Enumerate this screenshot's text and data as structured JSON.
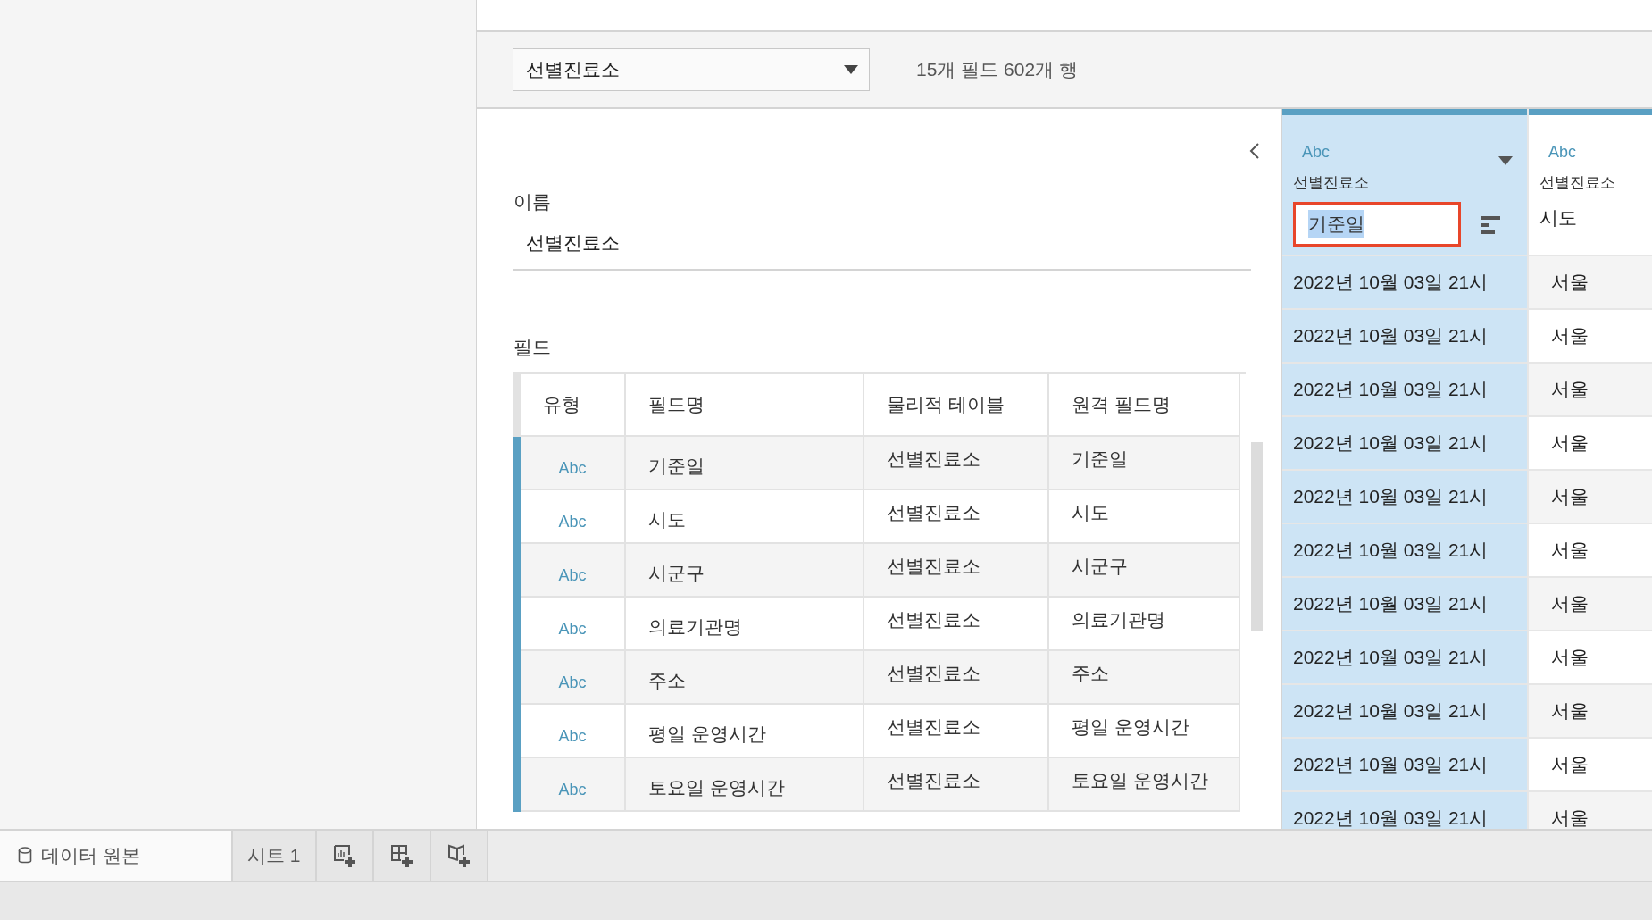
{
  "data_source_select": {
    "value": "선별진료소"
  },
  "summary": "15개 필드 602개 행",
  "name_field": {
    "label": "이름",
    "value": "선별진료소"
  },
  "fields_label": "필드",
  "fields_table": {
    "columns": [
      "유형",
      "필드명",
      "물리적 테이블",
      "원격 필드명"
    ],
    "rows": [
      {
        "type": "Abc",
        "field_name": "기준일",
        "physical_table": "선별진료소",
        "remote_field_name": "기준일"
      },
      {
        "type": "Abc",
        "field_name": "시도",
        "physical_table": "선별진료소",
        "remote_field_name": "시도"
      },
      {
        "type": "Abc",
        "field_name": "시군구",
        "physical_table": "선별진료소",
        "remote_field_name": "시군구"
      },
      {
        "type": "Abc",
        "field_name": "의료기관명",
        "physical_table": "선별진료소",
        "remote_field_name": "의료기관명"
      },
      {
        "type": "Abc",
        "field_name": "주소",
        "physical_table": "선별진료소",
        "remote_field_name": "주소"
      },
      {
        "type": "Abc",
        "field_name": "평일 운영시간",
        "physical_table": "선별진료소",
        "remote_field_name": "평일 운영시간"
      },
      {
        "type": "Abc",
        "field_name": "토요일 운영시간",
        "physical_table": "선별진료소",
        "remote_field_name": "토요일 운영시간"
      }
    ]
  },
  "grid": {
    "columns": [
      {
        "type": "Abc",
        "table": "선별진료소",
        "name": "기준일",
        "selected": true,
        "editing": true
      },
      {
        "type": "Abc",
        "table": "선별진료소",
        "name": "시도",
        "selected": false,
        "editing": false
      }
    ],
    "rows": [
      [
        "2022년 10월 03일 21시",
        "서울"
      ],
      [
        "2022년 10월 03일 21시",
        "서울"
      ],
      [
        "2022년 10월 03일 21시",
        "서울"
      ],
      [
        "2022년 10월 03일 21시",
        "서울"
      ],
      [
        "2022년 10월 03일 21시",
        "서울"
      ],
      [
        "2022년 10월 03일 21시",
        "서울"
      ],
      [
        "2022년 10월 03일 21시",
        "서울"
      ],
      [
        "2022년 10월 03일 21시",
        "서울"
      ],
      [
        "2022년 10월 03일 21시",
        "서울"
      ],
      [
        "2022년 10월 03일 21시",
        "서울"
      ],
      [
        "2022년 10월 03일 21시",
        "서울"
      ]
    ]
  },
  "bottom_tabs": [
    {
      "kind": "data-source",
      "label": "데이터 원본",
      "selected": true
    },
    {
      "kind": "sheet",
      "label": "시트 1",
      "selected": false
    },
    {
      "kind": "new-sheet"
    },
    {
      "kind": "new-dashboard"
    },
    {
      "kind": "new-story"
    }
  ]
}
